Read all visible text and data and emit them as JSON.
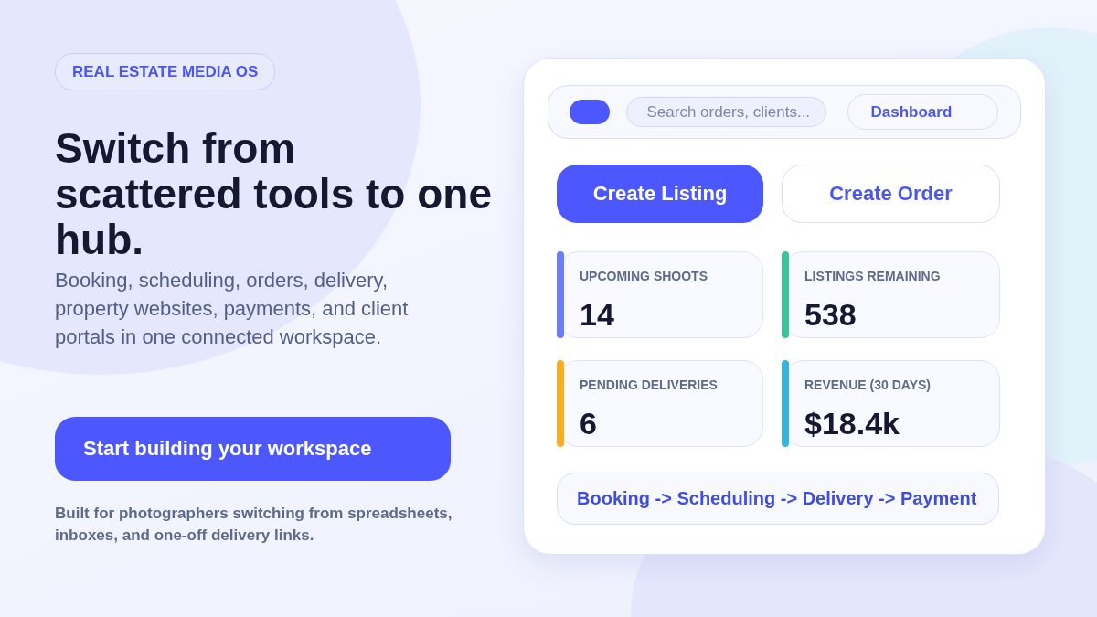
{
  "badge": "REAL ESTATE MEDIA OS",
  "headline": "Switch from scattered tools to one hub.",
  "description": "Booking, scheduling, orders, delivery, property websites, payments, and client portals in one connected workspace.",
  "cta": "Start building your workspace",
  "footnote": "Built for photographers switching from spreadsheets, inboxes, and one-off delivery links.",
  "app": {
    "search": {
      "placeholder": "Search orders, clients..."
    },
    "nav_button": "Dashboard",
    "actions": [
      {
        "label": "Create Listing",
        "kind": "primary"
      },
      {
        "label": "Create Order",
        "kind": "secondary"
      }
    ],
    "metrics": [
      {
        "label": "UPCOMING SHOOTS",
        "value": "14",
        "color": "#6a7cff"
      },
      {
        "label": "LISTINGS REMAINING",
        "value": "538",
        "color": "#3cc39e"
      },
      {
        "label": "PENDING DELIVERIES",
        "value": "6",
        "color": "#fbad21"
      },
      {
        "label": "REVENUE (30 DAYS)",
        "value": "$18.4k",
        "color": "#35b4e0"
      }
    ],
    "flow": "Booking -> Scheduling -> Delivery -> Payment"
  }
}
